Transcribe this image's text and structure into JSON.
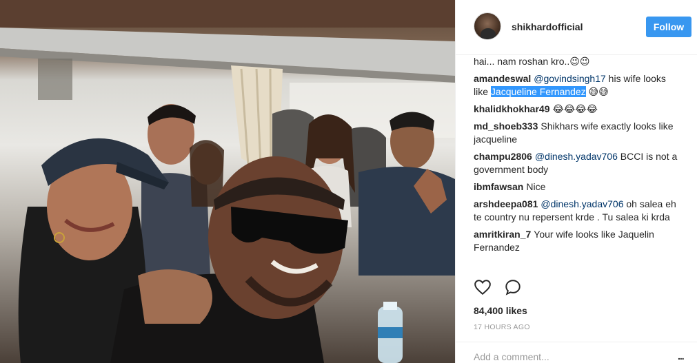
{
  "post": {
    "photo_alt": "Group selfie inside a bus"
  },
  "header": {
    "username": "shikhardofficial",
    "follow_label": "Follow"
  },
  "comments": [
    {
      "user": "",
      "parts": [
        {
          "t": "hai... nam roshan kro..😉😉"
        }
      ]
    },
    {
      "user": "amandeswal",
      "parts": [
        {
          "t": "@govindsingh17",
          "mention": true
        },
        {
          "t": " his wife looks like "
        },
        {
          "t": "Jacqueline Fernandez",
          "highlight": true
        },
        {
          "t": " 😅😅"
        }
      ]
    },
    {
      "user": "khalidkhokhar49",
      "parts": [
        {
          "t": "😂😂😂😂"
        }
      ]
    },
    {
      "user": "md_shoeb333",
      "parts": [
        {
          "t": "Shikhars wife exactly looks like jacqueline"
        }
      ]
    },
    {
      "user": "champu2806",
      "parts": [
        {
          "t": "@dinesh.yadav706",
          "mention": true
        },
        {
          "t": " BCCI is not a government body"
        }
      ]
    },
    {
      "user": "ibmfawsan",
      "parts": [
        {
          "t": "Nice"
        }
      ]
    },
    {
      "user": "arshdeepa081",
      "parts": [
        {
          "t": "@dinesh.yadav706",
          "mention": true
        },
        {
          "t": " oh salea eh te country nu repersent krde . Tu salea ki krda"
        }
      ]
    },
    {
      "user": "amritkiran_7",
      "parts": [
        {
          "t": "Your wife looks like Jaquelin Fernandez"
        }
      ]
    }
  ],
  "actions": {
    "like_icon": "heart-icon",
    "comment_icon": "comment-icon"
  },
  "likes_text": "84,400 likes",
  "time_text": "17 HOURS AGO",
  "comment_box": {
    "placeholder": "Add a comment...",
    "more_label": "..."
  }
}
